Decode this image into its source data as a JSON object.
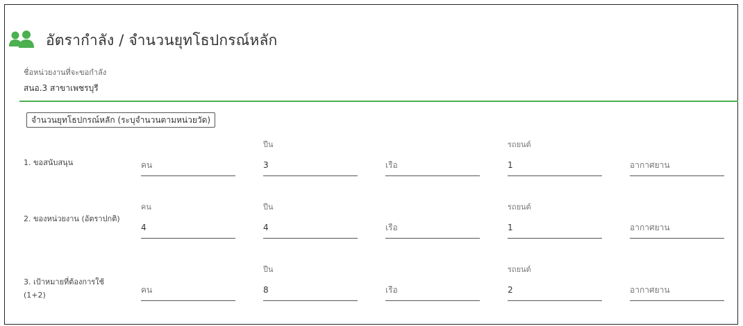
{
  "header": {
    "title": "อัตรากำลัง / จำนวนยุทโธปกรณ์หลัก",
    "icon": "users-icon",
    "icon_color": "#4caf50"
  },
  "unit": {
    "label": "ชื่อหน่วยงานที่จะขอกำลัง",
    "value": "สนอ.3 สาขาเพชรบุรี"
  },
  "section_button": "จำนวนยุทโธปกรณ์หลัก (ระบุจำนวนตามหน่วยวัด)",
  "rows": [
    {
      "label": "1. ขอสนับสนุน",
      "fields": [
        {
          "label": "",
          "value": "",
          "placeholder": "คน"
        },
        {
          "label": "ปืน",
          "value": "3",
          "placeholder": ""
        },
        {
          "label": "",
          "value": "",
          "placeholder": "เรือ"
        },
        {
          "label": "รถยนต์",
          "value": "1",
          "placeholder": ""
        },
        {
          "label": "",
          "value": "",
          "placeholder": "อากาศยาน"
        }
      ]
    },
    {
      "label": "2. ของหน่วยงาน (อัตราปกติ)",
      "fields": [
        {
          "label": "คน",
          "value": "4",
          "placeholder": ""
        },
        {
          "label": "ปืน",
          "value": "4",
          "placeholder": ""
        },
        {
          "label": "",
          "value": "",
          "placeholder": "เรือ"
        },
        {
          "label": "รถยนต์",
          "value": "1",
          "placeholder": ""
        },
        {
          "label": "",
          "value": "",
          "placeholder": "อากาศยาน"
        }
      ]
    },
    {
      "label": "3. เป้าหมายที่ต้องการใช้ (1+2)",
      "fields": [
        {
          "label": "",
          "value": "",
          "placeholder": "คน"
        },
        {
          "label": "ปืน",
          "value": "8",
          "placeholder": ""
        },
        {
          "label": "",
          "value": "",
          "placeholder": "เรือ"
        },
        {
          "label": "รถยนต์",
          "value": "2",
          "placeholder": ""
        },
        {
          "label": "",
          "value": "",
          "placeholder": "อากาศยาน"
        }
      ]
    }
  ]
}
